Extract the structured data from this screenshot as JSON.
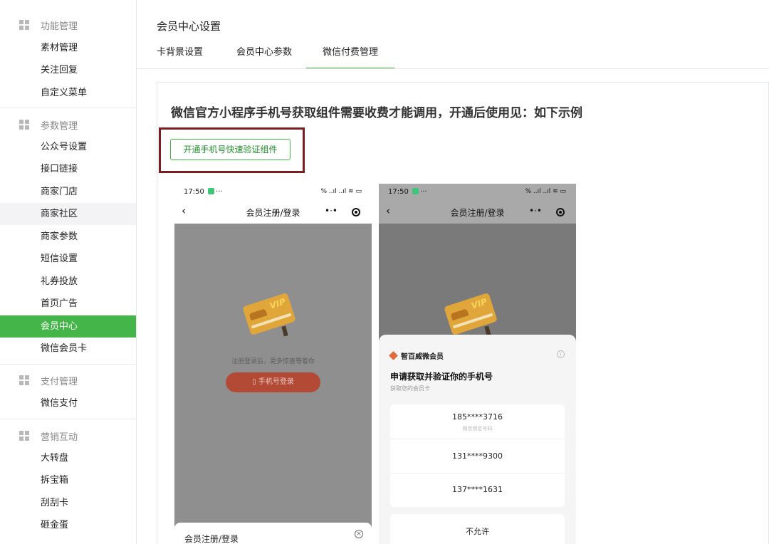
{
  "sidebar": {
    "groups": [
      {
        "title": "功能管理",
        "icon": "grid-icon",
        "items": [
          "素材管理",
          "关注回复",
          "自定义菜单"
        ]
      },
      {
        "title": "参数管理",
        "icon": "grid-icon",
        "items": [
          "公众号设置",
          "接口链接",
          "商家门店",
          "商家社区",
          "商家参数",
          "短信设置",
          "礼券投放",
          "首页广告",
          "会员中心",
          "微信会员卡"
        ]
      },
      {
        "title": "支付管理",
        "icon": "grid-icon",
        "items": [
          "微信支付"
        ]
      },
      {
        "title": "营销互动",
        "icon": "grid-icon",
        "items": [
          "大转盘",
          "拆宝箱",
          "刮刮卡",
          "砸金蛋"
        ]
      }
    ],
    "active_item": "会员中心",
    "hover_item": "商家社区"
  },
  "page": {
    "title": "会员中心设置",
    "tabs": [
      "卡背景设置",
      "会员中心参数",
      "微信付费管理"
    ],
    "active_tab": "微信付费管理"
  },
  "content": {
    "heading": "微信官方小程序手机号获取组件需要收费才能调用，开通后使用见：如下示例",
    "open_button": "开通手机号快速验证组件"
  },
  "phone_left": {
    "time": "17:50",
    "status_more": "···",
    "signal": "%  ..ıl ..ıl ≋ ▭",
    "nav_title": "会员注册/登录",
    "vip_text": "VIP",
    "hint": "注册登录后，更多惊喜等着你",
    "login_button": "手机号登录",
    "sheet_title": "会员注册/登录",
    "sheet_close": "×"
  },
  "phone_right": {
    "time": "17:50",
    "status_more": "···",
    "signal": "%  ..ıl ..ıl ≋ ▭",
    "nav_title": "会员注册/登录",
    "vip_text": "VIP",
    "brand": "智百威微会员",
    "info": "i",
    "request_title": "申请获取并验证你的手机号",
    "request_sub": "获取您的会员卡",
    "numbers": [
      {
        "number": "185****3716",
        "sub": "微信绑定号码"
      },
      {
        "number": "131****9300",
        "sub": ""
      },
      {
        "number": "137****1631",
        "sub": ""
      }
    ],
    "deny": "不允许"
  },
  "colors": {
    "accent": "#44b549",
    "highlight_border": "#7a1e22",
    "login_button": "#b24a36",
    "vip_card": "#e0a63a"
  }
}
